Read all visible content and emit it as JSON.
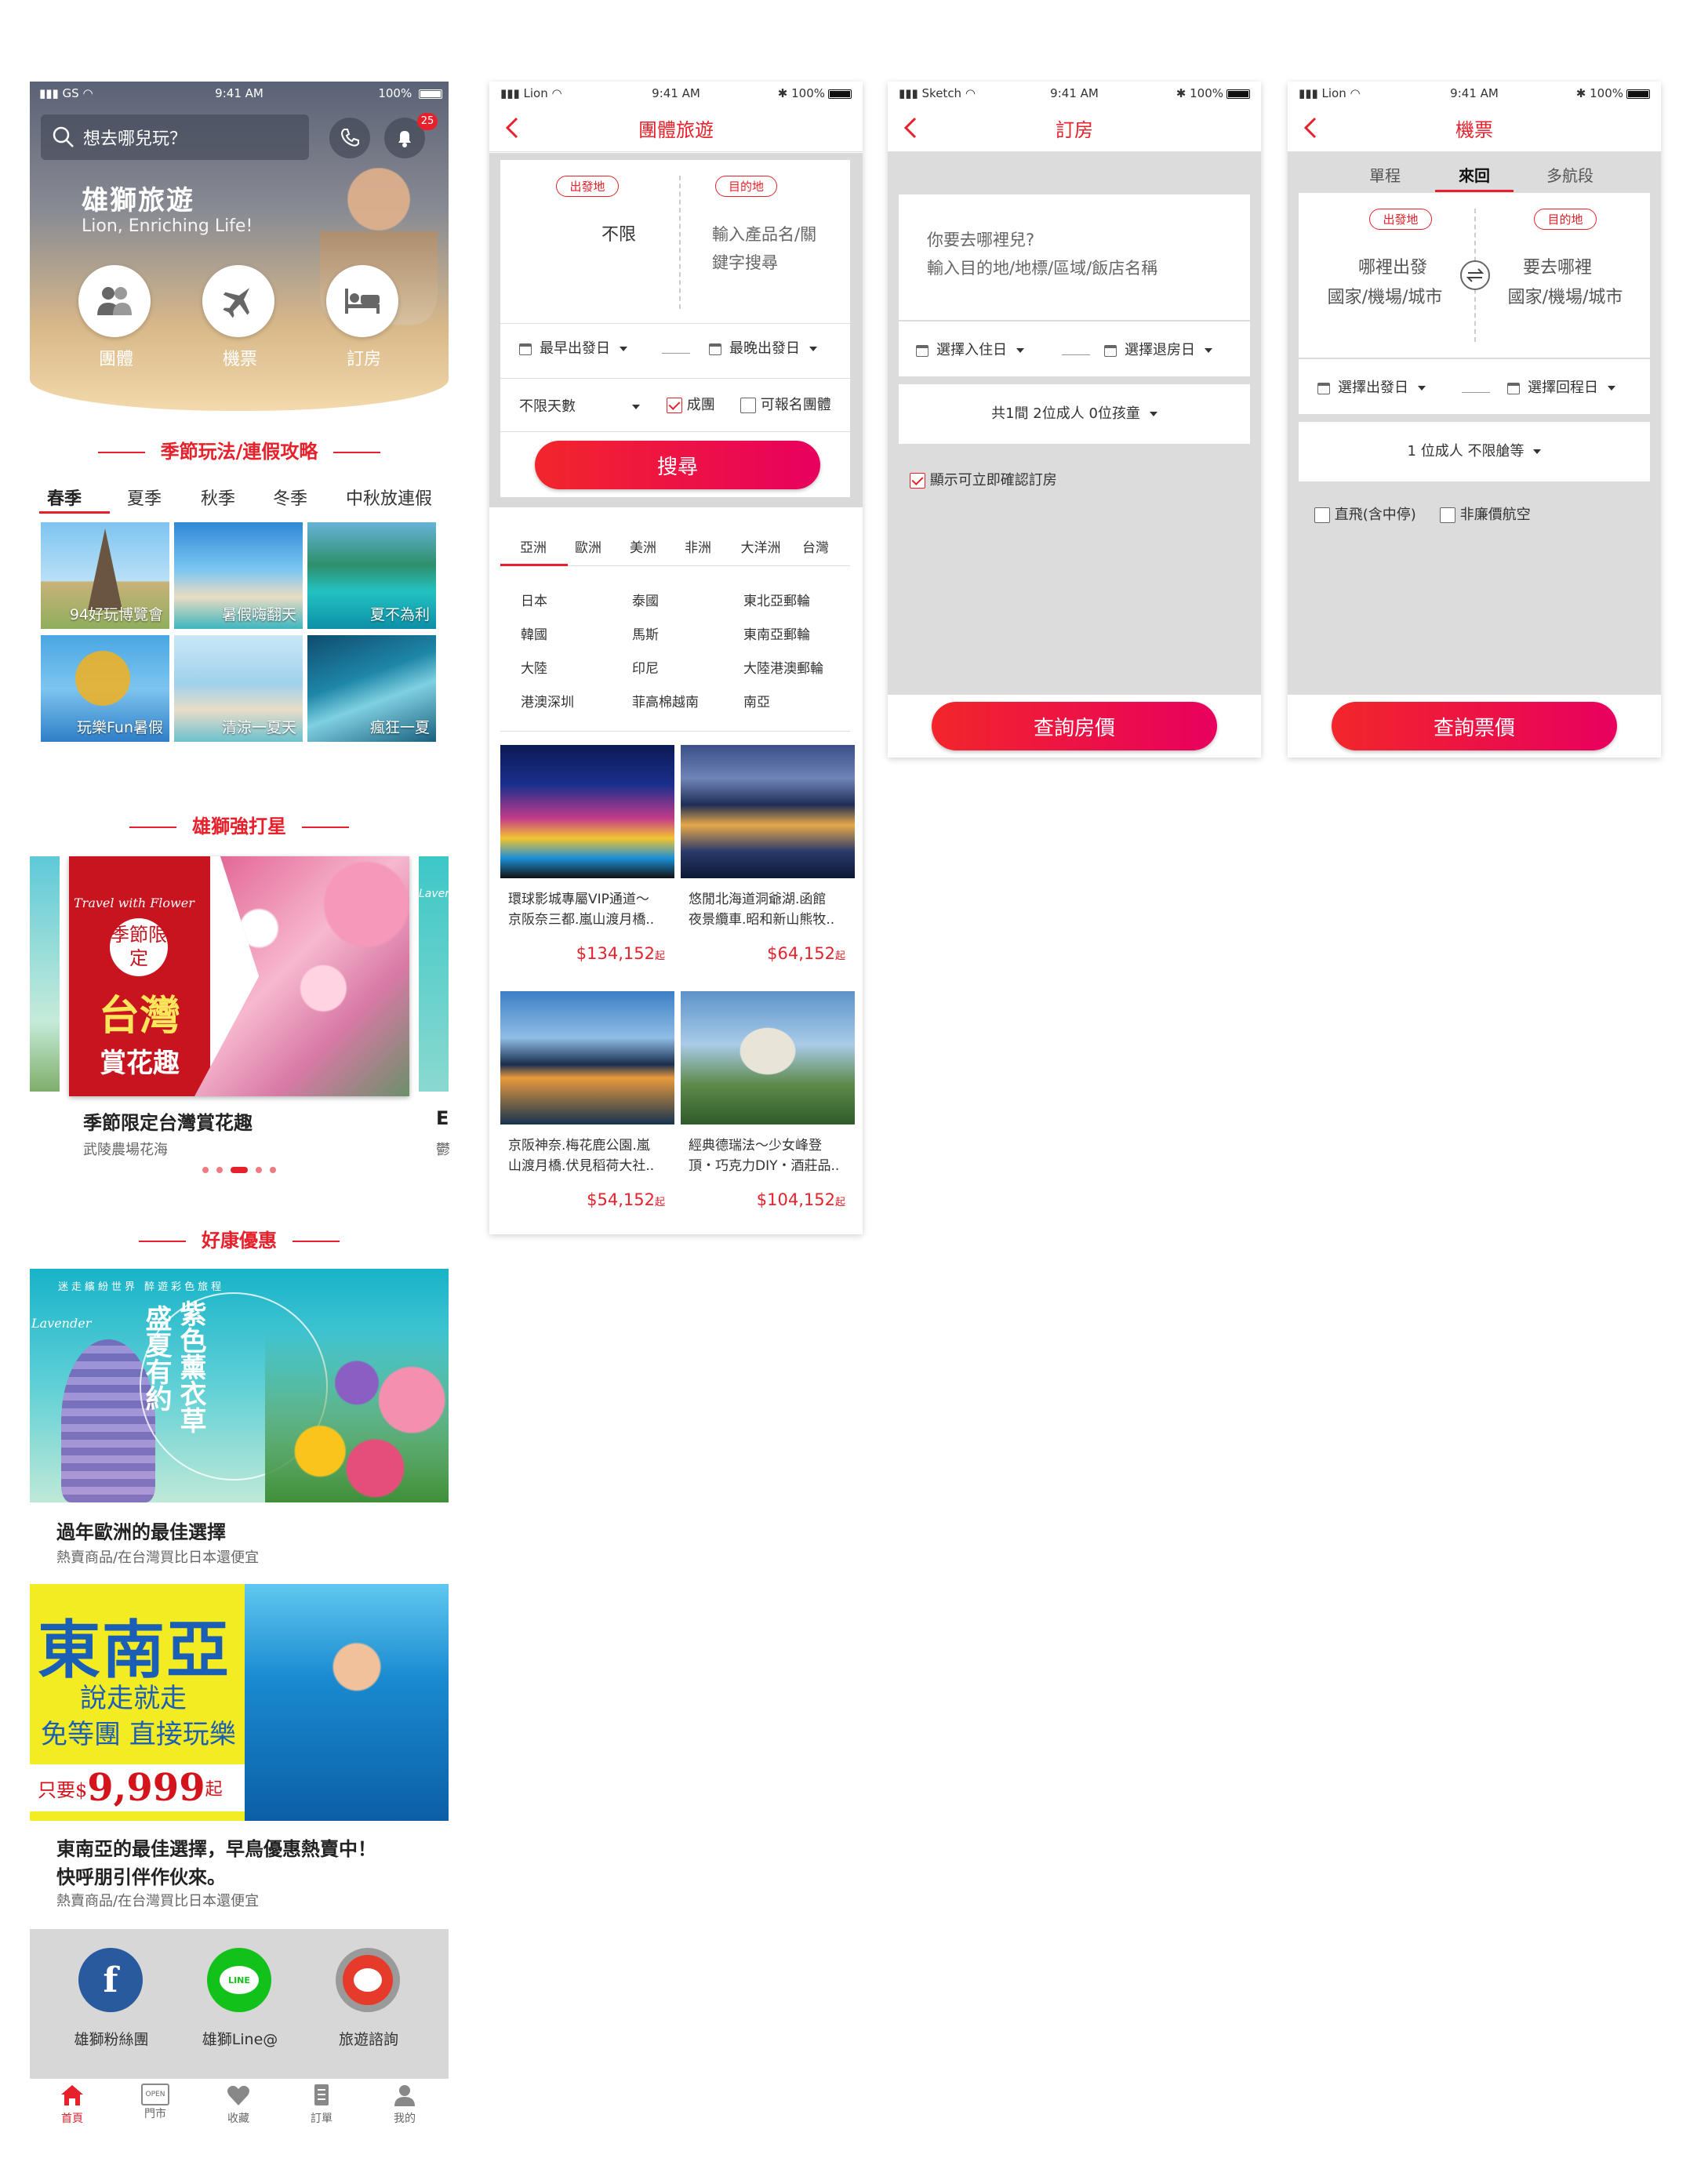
{
  "screen1": {
    "status": {
      "carrier": "GS",
      "time": "9:41 AM",
      "battery": "100%"
    },
    "search_placeholder": "想去哪兒玩？",
    "bell_badge": "25",
    "brand_title": "雄獅旅遊",
    "brand_slogan": "Lion, Enriching Life!",
    "quick_actions": [
      {
        "label": "團體",
        "icon": "group-icon"
      },
      {
        "label": "機票",
        "icon": "airplane-icon"
      },
      {
        "label": "訂房",
        "icon": "bed-icon"
      }
    ],
    "season_title": "季節玩法/連假攻略",
    "season_tabs": [
      "春季",
      "夏季",
      "秋季",
      "冬季",
      "中秋放連假"
    ],
    "season_tiles": [
      "94好玩博覽會",
      "暑假嗨翻天",
      "夏不為利",
      "玩樂Fun暑假",
      "清涼一夏天",
      "瘋狂一夏"
    ],
    "star_title": "雄獅強打星",
    "star_card": {
      "banner_text1": "Travel with Flower",
      "banner_badge": "季節限定",
      "banner_big": "台灣",
      "banner_sub": "賞花趣",
      "title": "季節限定台灣賞花趣",
      "subtitle": "武陵農場花海",
      "peek_right_title": "E",
      "peek_right_sub": "鬱",
      "peek_right_banner": "Laver"
    },
    "deal_title": "好康優惠",
    "deal1": {
      "banner_top": "迷走繽紛世界  醉遊彩色旅程",
      "banner_left": "Lavender",
      "banner_col1": "盛夏有約",
      "banner_col2": "紫色薰衣草",
      "title": "過年歐洲的最佳選擇",
      "subtitle": "熱賣商品/在台灣買比日本還便宜"
    },
    "deal2": {
      "banner_h1": "東南亞",
      "banner_h2": "說走就走",
      "banner_h3": "免等團 直接玩樂",
      "banner_price_prefix": "只要$",
      "banner_price": "9,999",
      "banner_price_suffix": "起",
      "title_l1": "東南亞的最佳選擇，早鳥優惠熱賣中！",
      "title_l2": "快呼朋引伴作伙來。",
      "subtitle": "熱賣商品/在台灣買比日本還便宜"
    },
    "social": [
      {
        "label": "雄獅粉絲團",
        "icon": "facebook-icon",
        "glyph": "f",
        "color": "#2a5a9e"
      },
      {
        "label": "雄獅Line@",
        "icon": "line-icon",
        "glyph": "LINE",
        "color": "#12c21a"
      },
      {
        "label": "旅遊諮詢",
        "icon": "lion-mascot-icon",
        "glyph": "",
        "color": "#e63a2b"
      }
    ],
    "tabbar": [
      {
        "label": "首頁",
        "icon": "home-icon"
      },
      {
        "label": "門市",
        "icon": "store-open-icon"
      },
      {
        "label": "收藏",
        "icon": "heart-icon"
      },
      {
        "label": "訂單",
        "icon": "order-list-icon"
      },
      {
        "label": "我的",
        "icon": "profile-icon"
      }
    ],
    "store_sign": "OPEN"
  },
  "screen2": {
    "status": {
      "carrier": "Lion",
      "time": "9:41 AM",
      "battery": "100%"
    },
    "nav_title": "團體旅遊",
    "from_label": "出發地",
    "to_label": "目的地",
    "from_value": "不限",
    "to_placeholder_l1": "輸入產品名/關",
    "to_placeholder_l2": "鍵字搜尋",
    "date_from": "最早出發日",
    "date_to": "最晚出發日",
    "days": "不限天數",
    "check_confirmed": "成團",
    "check_available": "可報名團體",
    "search_btn": "搜尋",
    "region_tabs": [
      "亞洲",
      "歐洲",
      "美洲",
      "非洲",
      "大洋洲",
      "台灣"
    ],
    "regions": [
      [
        "日本",
        "泰國",
        "東北亞郵輪"
      ],
      [
        "韓國",
        "馬斯",
        "東南亞郵輪"
      ],
      [
        "大陸",
        "印尼",
        "大陸港澳郵輪"
      ],
      [
        "港澳深圳",
        "菲高棉越南",
        "南亞"
      ]
    ],
    "products": [
      {
        "t1": "環球影城專屬VIP通道～",
        "t2": "京阪奈三都.嵐山渡月橋..",
        "price": "$134,152",
        "suffix": "起"
      },
      {
        "t1": "悠閒北海道洞爺湖.函館",
        "t2": "夜景纜車.昭和新山熊牧..",
        "price": "$64,152",
        "suffix": "起"
      },
      {
        "t1": "京阪神奈.梅花鹿公園.嵐",
        "t2": "山渡月橋.伏見稻荷大社..",
        "price": "$54,152",
        "suffix": "起"
      },
      {
        "t1": "經典德瑞法～少女峰登",
        "t2": "頂・巧克力DIY・酒莊品..",
        "price": "$104,152",
        "suffix": "起"
      }
    ]
  },
  "screen3": {
    "status": {
      "carrier": "Sketch",
      "time": "9:41 AM",
      "battery": "100%"
    },
    "nav_title": "訂房",
    "dest_l1": "你要去哪裡兒?",
    "dest_l2": "輸入目的地/地標/區域/飯店名稱",
    "checkin": "選擇入住日",
    "checkout": "選擇退房日",
    "guests": "共1間   2位成人   0位孩童",
    "instant_confirm": "顯示可立即確認訂房",
    "search_btn": "查詢房價"
  },
  "screen4": {
    "status": {
      "carrier": "Lion",
      "time": "9:41 AM",
      "battery": "100%"
    },
    "nav_title": "機票",
    "trip_tabs": [
      "單程",
      "來回",
      "多航段"
    ],
    "active_trip": 1,
    "from_label": "出發地",
    "to_label": "目的地",
    "from_l1": "哪裡出發",
    "from_l2": "國家/機場/城市",
    "to_l1": "要去哪裡",
    "to_l2": "國家/機場/城市",
    "depart": "選擇出發日",
    "return": "選擇回程日",
    "passengers": "1 位成人   不限艙等",
    "check_direct": "直飛(含中停)",
    "check_nonlcc": "非廉價航空",
    "search_btn": "查詢票價"
  }
}
